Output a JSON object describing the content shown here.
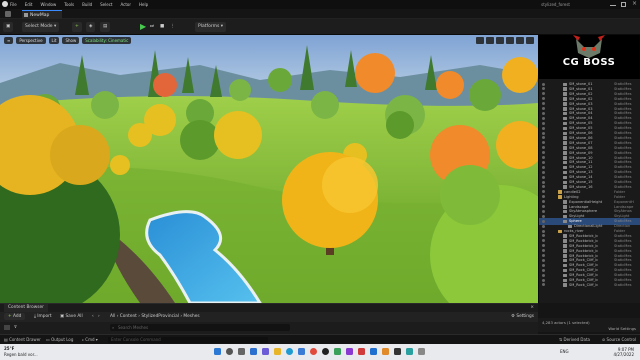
{
  "menu": [
    "File",
    "Edit",
    "Window",
    "Tools",
    "Build",
    "Select",
    "Actor",
    "Help"
  ],
  "project_name": "stylized_forest",
  "tab_label": "NewMap",
  "toolbar": {
    "select_mode": "Select Mode",
    "platforms": "Platforms"
  },
  "viewport": {
    "perspective": "Perspective",
    "lit": "Lit",
    "show": "Show",
    "scalability": "Scalability: Cinematic"
  },
  "outliner": {
    "rows": [
      {
        "name": "SM_stone_01",
        "type": "StaticMes",
        "indent": 2,
        "kind": "mesh"
      },
      {
        "name": "SM_stone_01",
        "type": "StaticMes",
        "indent": 2,
        "kind": "mesh"
      },
      {
        "name": "SM_stone_02",
        "type": "StaticMes",
        "indent": 2,
        "kind": "mesh"
      },
      {
        "name": "SM_stone_02",
        "type": "StaticMes",
        "indent": 2,
        "kind": "mesh"
      },
      {
        "name": "SM_stone_03",
        "type": "StaticMes",
        "indent": 2,
        "kind": "mesh"
      },
      {
        "name": "SM_stone_03",
        "type": "StaticMes",
        "indent": 2,
        "kind": "mesh"
      },
      {
        "name": "SM_stone_04",
        "type": "StaticMes",
        "indent": 2,
        "kind": "mesh"
      },
      {
        "name": "SM_stone_04",
        "type": "StaticMes",
        "indent": 2,
        "kind": "mesh"
      },
      {
        "name": "SM_stone_05",
        "type": "StaticMes",
        "indent": 2,
        "kind": "mesh"
      },
      {
        "name": "SM_stone_05",
        "type": "StaticMes",
        "indent": 2,
        "kind": "mesh"
      },
      {
        "name": "SM_stone_06",
        "type": "StaticMes",
        "indent": 2,
        "kind": "mesh"
      },
      {
        "name": "SM_stone_06",
        "type": "StaticMes",
        "indent": 2,
        "kind": "mesh"
      },
      {
        "name": "SM_stone_07",
        "type": "StaticMes",
        "indent": 2,
        "kind": "mesh"
      },
      {
        "name": "SM_stone_08",
        "type": "StaticMes",
        "indent": 2,
        "kind": "mesh"
      },
      {
        "name": "SM_stone_09",
        "type": "StaticMes",
        "indent": 2,
        "kind": "mesh"
      },
      {
        "name": "SM_stone_10",
        "type": "StaticMes",
        "indent": 2,
        "kind": "mesh"
      },
      {
        "name": "SM_stone_11",
        "type": "StaticMes",
        "indent": 2,
        "kind": "mesh"
      },
      {
        "name": "SM_stone_12",
        "type": "StaticMes",
        "indent": 2,
        "kind": "mesh"
      },
      {
        "name": "SM_stone_13",
        "type": "StaticMes",
        "indent": 2,
        "kind": "mesh"
      },
      {
        "name": "SM_stone_14",
        "type": "StaticMes",
        "indent": 2,
        "kind": "mesh"
      },
      {
        "name": "SM_stone_15",
        "type": "StaticMes",
        "indent": 2,
        "kind": "mesh"
      },
      {
        "name": "SM_stone_16",
        "type": "StaticMes",
        "indent": 2,
        "kind": "mesh"
      },
      {
        "name": "candle02",
        "type": "Folder",
        "indent": 1,
        "kind": "folder"
      },
      {
        "name": "Lighting",
        "type": "Folder",
        "indent": 1,
        "kind": "folder"
      },
      {
        "name": "ExponentialHeight",
        "type": "ExponentH",
        "indent": 2,
        "kind": "mesh"
      },
      {
        "name": "Landscape",
        "type": "Landscape",
        "indent": 2,
        "kind": "mesh"
      },
      {
        "name": "SkyAtmosphere",
        "type": "SkyAtmos",
        "indent": 2,
        "kind": "mesh"
      },
      {
        "name": "SkyLight",
        "type": "SkyLight",
        "indent": 2,
        "kind": "mesh"
      },
      {
        "name": "Sphere",
        "type": "StaticMes",
        "indent": 2,
        "kind": "mesh",
        "selected": true
      },
      {
        "name": "DirectionalLight",
        "type": "Direction",
        "indent": 3,
        "kind": "mesh"
      },
      {
        "name": "rocks_river",
        "type": "Folder",
        "indent": 1,
        "kind": "folder"
      },
      {
        "name": "SM_Rockbrick_b",
        "type": "StaticMes",
        "indent": 2,
        "kind": "mesh"
      },
      {
        "name": "SM_Rockbrick_b",
        "type": "StaticMes",
        "indent": 2,
        "kind": "mesh"
      },
      {
        "name": "SM_Rockbrick_b",
        "type": "StaticMes",
        "indent": 2,
        "kind": "mesh"
      },
      {
        "name": "SM_Rockbrick_b",
        "type": "StaticMes",
        "indent": 2,
        "kind": "mesh"
      },
      {
        "name": "SM_Rockbrick_b",
        "type": "StaticMes",
        "indent": 2,
        "kind": "mesh"
      },
      {
        "name": "SM_Rock_Cliff_b",
        "type": "StaticMes",
        "indent": 2,
        "kind": "mesh"
      },
      {
        "name": "SM_Rock_Cliff_b",
        "type": "StaticMes",
        "indent": 2,
        "kind": "mesh"
      },
      {
        "name": "SM_Rock_Cliff_b",
        "type": "StaticMes",
        "indent": 2,
        "kind": "mesh"
      },
      {
        "name": "SM_Rock_Cliff_b",
        "type": "StaticMes",
        "indent": 2,
        "kind": "mesh"
      },
      {
        "name": "SM_Rock_Cliff_b",
        "type": "StaticMes",
        "indent": 2,
        "kind": "mesh"
      },
      {
        "name": "SM_Rock_Cliff_b",
        "type": "StaticMes",
        "indent": 2,
        "kind": "mesh"
      }
    ],
    "actor_count": "4,283 actors (1 selected)",
    "world_settings": "World Settings"
  },
  "watermark": "CG BOSS",
  "content_browser": {
    "title": "Content Browser",
    "add": "Add",
    "import": "Import",
    "save_all": "Save All",
    "path": [
      "All",
      "Content",
      "StylizedProvincial",
      "Meshes"
    ],
    "settings": "Settings",
    "search_placeholder": "Search Meshes"
  },
  "bottom_bar": {
    "content_drawer": "Content Drawer",
    "output_log": "Output Log",
    "cmd": "Cmd",
    "cmd_placeholder": "Enter Console Command",
    "derived_data": "Derived Data",
    "source_control": "Source Control"
  },
  "taskbar": {
    "temp": "25°F",
    "weather": "Regen bald vor...",
    "lang": "ENG",
    "time": "9:07 PM",
    "date": "4/27/2022"
  }
}
